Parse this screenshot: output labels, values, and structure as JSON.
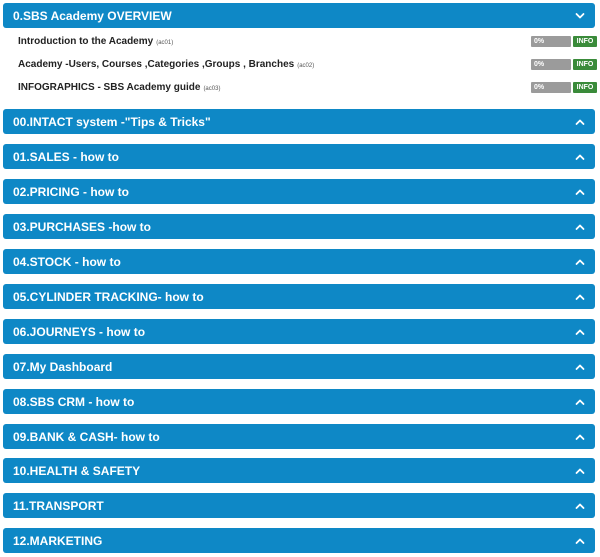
{
  "sections": [
    {
      "title": "0.SBS Academy OVERVIEW",
      "expanded": true
    },
    {
      "title": "00.INTACT system -\"Tips & Tricks\"",
      "expanded": false
    },
    {
      "title": "01.SALES - how to",
      "expanded": false
    },
    {
      "title": "02.PRICING - how to",
      "expanded": false
    },
    {
      "title": "03.PURCHASES -how to",
      "expanded": false
    },
    {
      "title": "04.STOCK - how to",
      "expanded": false
    },
    {
      "title": "05.CYLINDER TRACKING- how to",
      "expanded": false
    },
    {
      "title": "06.JOURNEYS - how to",
      "expanded": false
    },
    {
      "title": "07.My Dashboard",
      "expanded": false
    },
    {
      "title": "08.SBS CRM - how to",
      "expanded": false
    },
    {
      "title": "09.BANK & CASH- how to",
      "expanded": false
    },
    {
      "title": "10.HEALTH & SAFETY",
      "expanded": false
    },
    {
      "title": "11.TRANSPORT",
      "expanded": false
    },
    {
      "title": "12.MARKETING",
      "expanded": false
    }
  ],
  "overview_courses": [
    {
      "title": "Introduction to the Academy",
      "code": "(ac01)",
      "progress_label": "0%",
      "progress": 0,
      "info_label": "INFO"
    },
    {
      "title": "Academy -Users, Courses ,Categories ,Groups , Branches",
      "code": "(ac02)",
      "progress_label": "0%",
      "progress": 0,
      "info_label": "INFO"
    },
    {
      "title": "INFOGRAPHICS - SBS Academy guide",
      "code": "(ac03)",
      "progress_label": "0%",
      "progress": 0,
      "info_label": "INFO"
    }
  ],
  "icons": {
    "expanded": "chevron-down-icon",
    "collapsed": "chevron-up-icon"
  },
  "colors": {
    "header_bg": "#0e88c6",
    "header_text": "#ffffff",
    "progress_bg": "#9b9b9b",
    "progress_fill": "#3a9d4b",
    "info_bg": "#3a8b3a"
  }
}
